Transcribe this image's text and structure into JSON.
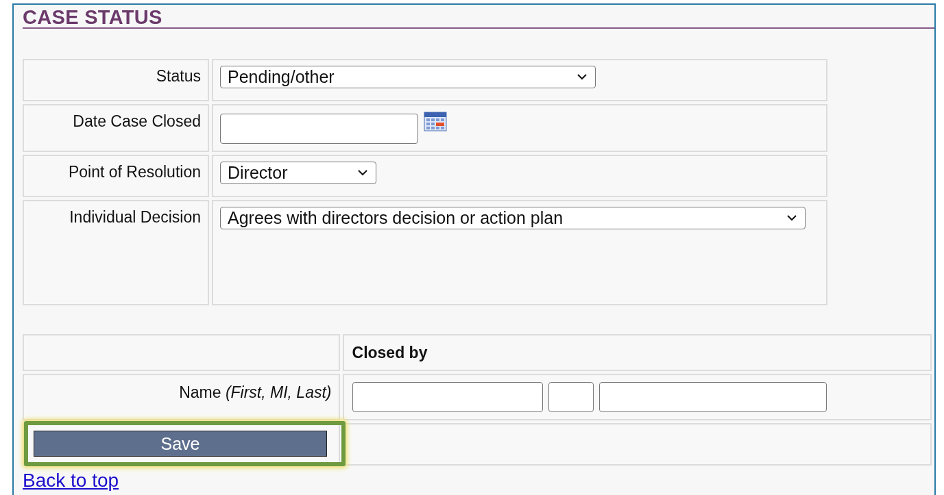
{
  "section_title": "CASE STATUS",
  "fields": [
    {
      "label": "Status",
      "kind": "select",
      "value": "Pending/other"
    },
    {
      "label": "Date Case Closed",
      "kind": "date"
    },
    {
      "label": "Point of Resolution",
      "kind": "select",
      "value": "Director"
    },
    {
      "label": "Individual Decision",
      "kind": "select",
      "value": "Agrees with directors decision or action plan"
    }
  ],
  "closed_by": {
    "heading": "Closed by",
    "name_label": "Name *(First, MI, Last)*"
  },
  "save_button": {
    "label": "Save",
    "highlighted": true
  },
  "back_link": "Back to top"
}
